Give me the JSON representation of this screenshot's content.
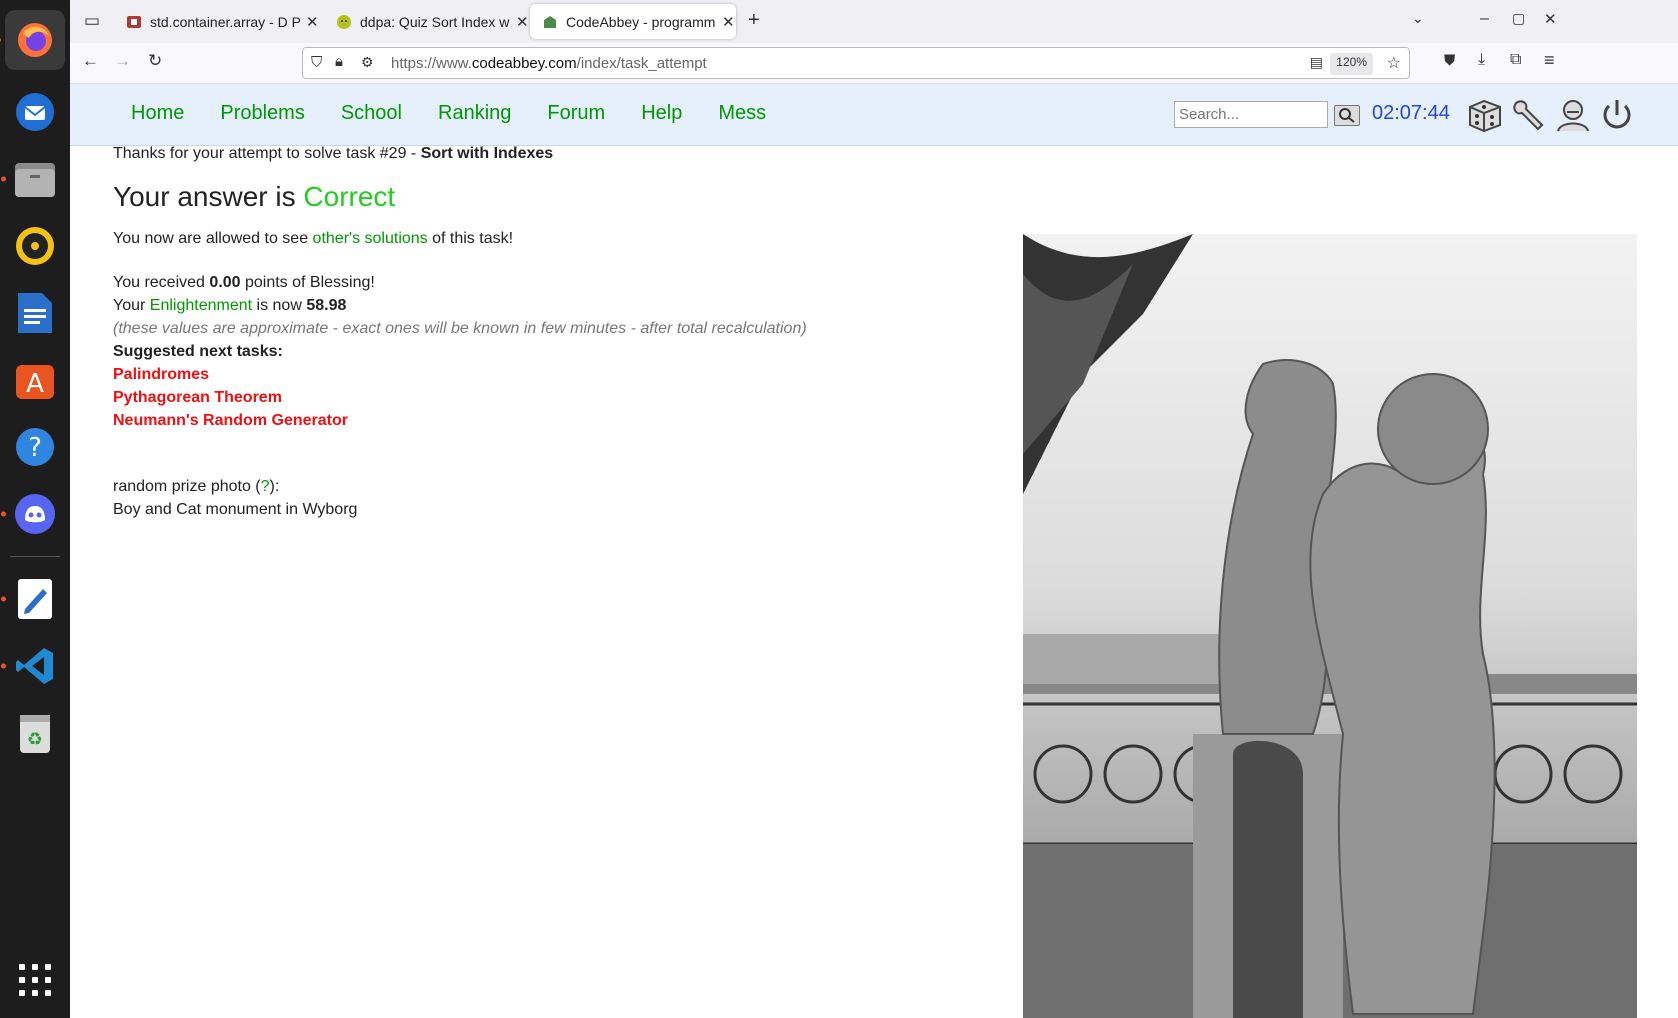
{
  "browser": {
    "tabs": [
      {
        "title": "std.container.array - D Pr",
        "icon": "d-lang-icon"
      },
      {
        "title": "ddpa: Quiz Sort Index wit",
        "icon": "ddpa-icon"
      },
      {
        "title": "CodeAbbey - programmin",
        "icon": "codeabbey-icon",
        "active": true
      }
    ],
    "url_prefix": "https://www.",
    "url_domain": "codeabbey.com",
    "url_path": "/index/task_attempt",
    "zoom": "120%"
  },
  "site": {
    "nav": [
      "Home",
      "Problems",
      "School",
      "Ranking",
      "Forum",
      "Help",
      "Mess"
    ],
    "search_placeholder": "Search...",
    "clock": "02:07:44"
  },
  "result": {
    "thanks_prefix": "Thanks for your attempt to solve task #29 - ",
    "task_name": "Sort with Indexes",
    "answer_prefix": "Your answer is ",
    "answer_status": "Correct",
    "allowed_prefix": "You now are allowed to see ",
    "allowed_link": "other's solutions",
    "allowed_suffix": " of this task!",
    "received_prefix": "You received ",
    "blessing_points": "0.00",
    "received_suffix": " points of Blessing!",
    "your": "Your ",
    "enlightenment_link": "Enlightenment",
    "is_now": " is now ",
    "enlightenment_value": "58.98",
    "note": "(these values are approximate - exact ones will be known in few minutes - after total recalculation)",
    "suggested_title": "Suggested next tasks:",
    "suggested": [
      "Palindromes",
      "Pythagorean Theorem",
      "Neumann's Random Generator"
    ],
    "prize_prefix": "random prize photo (",
    "prize_link": "?",
    "prize_suffix": "):",
    "photo_caption": "Boy and Cat monument in Wyborg"
  },
  "colors": {
    "nav_green": "#009900",
    "correct": "#22cc22",
    "task_red": "#ee1111",
    "clock_blue": "#2244ee",
    "header_bg": "#e6f0fc"
  }
}
